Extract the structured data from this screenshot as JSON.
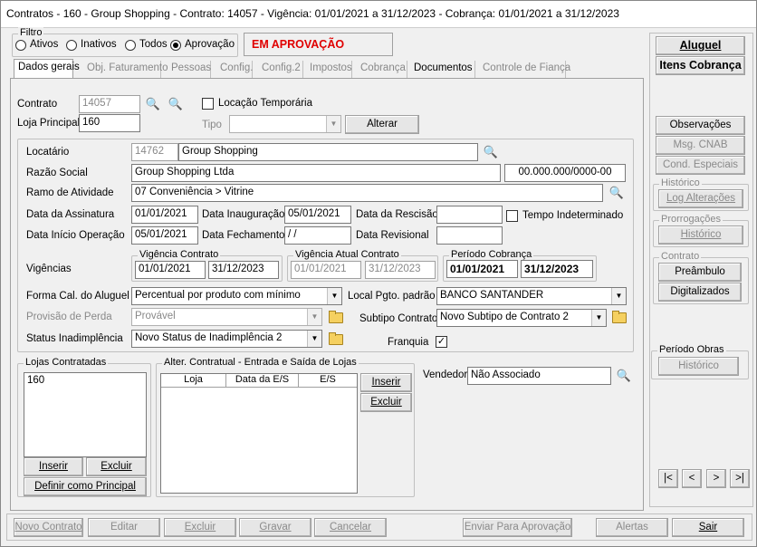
{
  "title": "Contratos - 160 - Group Shopping - Contrato: 14057 - Vigência: 01/01/2021 a 31/12/2023 - Cobrança: 01/01/2021 a 31/12/2023",
  "filtro": {
    "legend": "Filtro",
    "ativos": "Ativos",
    "inativos": "Inativos",
    "todos": "Todos",
    "aprovacao": "Aprovação",
    "status": "EM APROVAÇÃO"
  },
  "tabs": [
    "Dados gerais",
    "Obj. Faturamento",
    "Pessoas",
    "Config.",
    "Config.2",
    "Impostos",
    "Cobrança",
    "Documentos",
    "Controle de Fiança"
  ],
  "contrato": {
    "label": "Contrato",
    "value": "14057",
    "loja_label": "Loja Principal",
    "loja_value": "160",
    "locacao_temp": "Locação Temporária",
    "tipo_label": "Tipo",
    "tipo_value": "",
    "alterar": "Alterar"
  },
  "locatario": {
    "label": "Locatário",
    "code": "14762",
    "name": "Group Shopping",
    "razao_label": "Razão Social",
    "razao": "Group Shopping Ltda",
    "cnpj": "00.000.000/0000-00",
    "ramo_label": "Ramo de Atividade",
    "ramo": "07 Conveniência > Vitrine"
  },
  "datas": {
    "assinatura_label": "Data da Assinatura",
    "assinatura": "01/01/2021",
    "inauguracao_label": "Data Inauguração",
    "inauguracao": "05/01/2021",
    "rescisao_label": "Data da Rescisão",
    "rescisao": "",
    "tempo_indet": "Tempo Indeterminado",
    "inicio_label": "Data Início Operação",
    "inicio": "05/01/2021",
    "fechamento_label": "Data Fechamento",
    "fechamento": " / /",
    "revisional_label": "Data Revisional",
    "revisional": ""
  },
  "vigencias": {
    "label": "Vigências",
    "contrato_legend": "Vigência Contrato",
    "c_ini": "01/01/2021",
    "c_fim": "31/12/2023",
    "atual_legend": "Vigência Atual Contrato",
    "a_ini": "01/01/2021",
    "a_fim": "31/12/2023",
    "cob_legend": "Período Cobrança",
    "p_ini": "01/01/2021",
    "p_fim": "31/12/2023"
  },
  "forma": {
    "label": "Forma Cal. do Aluguel",
    "value": "Percentual por produto com mínimo",
    "local_label": "Local Pgto. padrão",
    "local_value": "BANCO SANTANDER"
  },
  "provisao": {
    "label": "Provisão de Perda",
    "value": "Provável",
    "subtipo_label": "Subtipo Contrato",
    "subtipo_value": "Novo Subtipo de Contrato 2"
  },
  "status_inad": {
    "label": "Status Inadimplência",
    "value": "Novo Status de Inadimplência 2",
    "franquia": "Franquia"
  },
  "lojas": {
    "legend": "Lojas Contratadas",
    "items": [
      "160"
    ],
    "inserir": "Inserir",
    "excluir": "Excluir",
    "definir": "Definir como Principal"
  },
  "alter": {
    "legend": "Alter. Contratual - Entrada e Saída de Lojas",
    "cols": [
      "Loja",
      "Data da E/S",
      "E/S"
    ],
    "inserir": "Inserir",
    "excluir": "Excluir"
  },
  "vendedor": {
    "label": "Vendedor",
    "value": "Não Associado"
  },
  "side": {
    "aluguel": "Aluguel",
    "itens": "Itens Cobrança",
    "observacoes": "Observações",
    "msg_cnab": "Msg. CNAB",
    "cond": "Cond. Especiais",
    "historico_legend": "Histórico",
    "log": "Log Alterações",
    "prorrog_legend": "Prorrogações",
    "prorrog_hist": "Histórico",
    "contrato_legend": "Contrato",
    "preambulo": "Preâmbulo",
    "digitalizados": "Digitalizados",
    "obras_legend": "Período Obras",
    "obras_hist": "Histórico"
  },
  "nav": [
    "|<",
    "<",
    ">",
    ">|"
  ],
  "bottom": {
    "novo": "Novo Contrato",
    "editar": "Editar",
    "excluir": "Excluir",
    "gravar": "Gravar",
    "cancelar": "Cancelar",
    "enviar": "Enviar Para Aprovação",
    "alertas": "Alertas",
    "sair": "Sair"
  }
}
